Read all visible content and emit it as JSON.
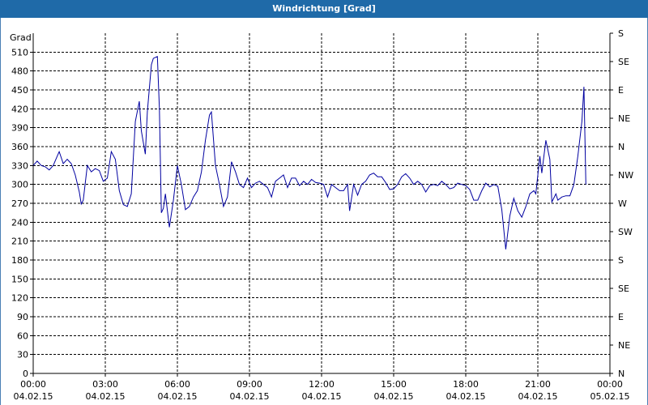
{
  "window": {
    "title": "Windrichtung [Grad]"
  },
  "colors": {
    "titlebar": "#1f6aa8",
    "line": "#0000a0",
    "grid": "#000000"
  },
  "chart_data": {
    "type": "line",
    "title": "Windrichtung [Grad]",
    "ylabel": "Grad",
    "ylim": [
      0,
      540
    ],
    "yticks": [
      0,
      30,
      60,
      90,
      120,
      150,
      180,
      210,
      240,
      270,
      300,
      330,
      360,
      390,
      420,
      450,
      480,
      510
    ],
    "y2ticks": [
      {
        "value": 0,
        "label": "N"
      },
      {
        "value": 45,
        "label": "NE"
      },
      {
        "value": 90,
        "label": "E"
      },
      {
        "value": 135,
        "label": "SE"
      },
      {
        "value": 180,
        "label": "S"
      },
      {
        "value": 225,
        "label": "SW"
      },
      {
        "value": 270,
        "label": "W"
      },
      {
        "value": 315,
        "label": "NW"
      },
      {
        "value": 360,
        "label": "N"
      },
      {
        "value": 405,
        "label": "NE"
      },
      {
        "value": 450,
        "label": "E"
      },
      {
        "value": 495,
        "label": "SE"
      },
      {
        "value": 540,
        "label": "S"
      }
    ],
    "xlim": [
      "04.02.15 00:00",
      "05.02.15 00:00"
    ],
    "xticks": [
      {
        "time": "00:00",
        "date": "04.02.15"
      },
      {
        "time": "03:00",
        "date": "04.02.15"
      },
      {
        "time": "06:00",
        "date": "04.02.15"
      },
      {
        "time": "09:00",
        "date": "04.02.15"
      },
      {
        "time": "12:00",
        "date": "04.02.15"
      },
      {
        "time": "15:00",
        "date": "04.02.15"
      },
      {
        "time": "18:00",
        "date": "04.02.15"
      },
      {
        "time": "21:00",
        "date": "04.02.15"
      },
      {
        "time": "00:00",
        "date": "05.02.15"
      }
    ],
    "grid": true,
    "series": [
      {
        "points": [
          [
            "04.02.15 00:00",
            330
          ],
          [
            "04.02.15 00:10",
            337
          ],
          [
            "04.02.15 00:20",
            330
          ],
          [
            "04.02.15 00:30",
            328
          ],
          [
            "04.02.15 00:40",
            323
          ],
          [
            "04.02.15 00:50",
            330
          ],
          [
            "04.02.15 01:00",
            345
          ],
          [
            "04.02.15 01:05",
            352
          ],
          [
            "04.02.15 01:15",
            333
          ],
          [
            "04.02.15 01:25",
            340
          ],
          [
            "04.02.15 01:35",
            333
          ],
          [
            "04.02.15 01:45",
            315
          ],
          [
            "04.02.15 01:55",
            288
          ],
          [
            "04.02.15 02:00",
            269
          ],
          [
            "04.02.15 02:05",
            275
          ],
          [
            "04.02.15 02:15",
            330
          ],
          [
            "04.02.15 02:25",
            320
          ],
          [
            "04.02.15 02:35",
            325
          ],
          [
            "04.02.15 02:45",
            322
          ],
          [
            "04.02.15 02:55",
            305
          ],
          [
            "04.02.15 03:05",
            310
          ],
          [
            "04.02.15 03:15",
            352
          ],
          [
            "04.02.15 03:25",
            340
          ],
          [
            "04.02.15 03:35",
            290
          ],
          [
            "04.02.15 03:45",
            268
          ],
          [
            "04.02.15 03:55",
            265
          ],
          [
            "04.02.15 04:05",
            285
          ],
          [
            "04.02.15 04:15",
            400
          ],
          [
            "04.02.15 04:25",
            432
          ],
          [
            "04.02.15 04:30",
            385
          ],
          [
            "04.02.15 04:40",
            348
          ],
          [
            "04.02.15 04:45",
            415
          ],
          [
            "04.02.15 04:55",
            490
          ],
          [
            "04.02.15 05:00",
            500
          ],
          [
            "04.02.15 05:10",
            503
          ],
          [
            "04.02.15 05:15",
            420
          ],
          [
            "04.02.15 05:20",
            255
          ],
          [
            "04.02.15 05:25",
            262
          ],
          [
            "04.02.15 05:30",
            285
          ],
          [
            "04.02.15 05:40",
            232
          ],
          [
            "04.02.15 05:50",
            275
          ],
          [
            "04.02.15 06:00",
            330
          ],
          [
            "04.02.15 06:10",
            300
          ],
          [
            "04.02.15 06:20",
            260
          ],
          [
            "04.02.15 06:30",
            265
          ],
          [
            "04.02.15 06:40",
            280
          ],
          [
            "04.02.15 06:50",
            290
          ],
          [
            "04.02.15 07:00",
            320
          ],
          [
            "04.02.15 07:10",
            370
          ],
          [
            "04.02.15 07:20",
            410
          ],
          [
            "04.02.15 07:25",
            415
          ],
          [
            "04.02.15 07:35",
            330
          ],
          [
            "04.02.15 07:45",
            300
          ],
          [
            "04.02.15 07:55",
            265
          ],
          [
            "04.02.15 08:05",
            280
          ],
          [
            "04.02.15 08:15",
            336
          ],
          [
            "04.02.15 08:25",
            320
          ],
          [
            "04.02.15 08:35",
            300
          ],
          [
            "04.02.15 08:45",
            295
          ],
          [
            "04.02.15 08:55",
            310
          ],
          [
            "04.02.15 09:05",
            295
          ],
          [
            "04.02.15 09:15",
            302
          ],
          [
            "04.02.15 09:25",
            305
          ],
          [
            "04.02.15 09:35",
            300
          ],
          [
            "04.02.15 09:45",
            295
          ],
          [
            "04.02.15 09:55",
            280
          ],
          [
            "04.02.15 10:05",
            305
          ],
          [
            "04.02.15 10:15",
            310
          ],
          [
            "04.02.15 10:25",
            315
          ],
          [
            "04.02.15 10:35",
            295
          ],
          [
            "04.02.15 10:45",
            310
          ],
          [
            "04.02.15 10:55",
            310
          ],
          [
            "04.02.15 11:05",
            298
          ],
          [
            "04.02.15 11:15",
            305
          ],
          [
            "04.02.15 11:25",
            300
          ],
          [
            "04.02.15 11:35",
            308
          ],
          [
            "04.02.15 11:45",
            303
          ],
          [
            "04.02.15 11:55",
            302
          ],
          [
            "04.02.15 12:05",
            300
          ],
          [
            "04.02.15 12:15",
            280
          ],
          [
            "04.02.15 12:25",
            300
          ],
          [
            "04.02.15 12:35",
            295
          ],
          [
            "04.02.15 12:45",
            290
          ],
          [
            "04.02.15 12:55",
            290
          ],
          [
            "04.02.15 13:05",
            300
          ],
          [
            "04.02.15 13:10",
            258
          ],
          [
            "04.02.15 13:20",
            300
          ],
          [
            "04.02.15 13:30",
            283
          ],
          [
            "04.02.15 13:40",
            300
          ],
          [
            "04.02.15 13:50",
            305
          ],
          [
            "04.02.15 14:00",
            315
          ],
          [
            "04.02.15 14:10",
            318
          ],
          [
            "04.02.15 14:20",
            312
          ],
          [
            "04.02.15 14:30",
            312
          ],
          [
            "04.02.15 14:40",
            303
          ],
          [
            "04.02.15 14:50",
            292
          ],
          [
            "04.02.15 15:00",
            293
          ],
          [
            "04.02.15 15:10",
            300
          ],
          [
            "04.02.15 15:20",
            312
          ],
          [
            "04.02.15 15:30",
            317
          ],
          [
            "04.02.15 15:40",
            310
          ],
          [
            "04.02.15 15:50",
            300
          ],
          [
            "04.02.15 16:00",
            305
          ],
          [
            "04.02.15 16:10",
            300
          ],
          [
            "04.02.15 16:20",
            288
          ],
          [
            "04.02.15 16:30",
            298
          ],
          [
            "04.02.15 16:40",
            300
          ],
          [
            "04.02.15 16:50",
            298
          ],
          [
            "04.02.15 17:00",
            305
          ],
          [
            "04.02.15 17:10",
            300
          ],
          [
            "04.02.15 17:20",
            293
          ],
          [
            "04.02.15 17:30",
            295
          ],
          [
            "04.02.15 17:40",
            302
          ],
          [
            "04.02.15 17:50",
            300
          ],
          [
            "04.02.15 18:00",
            298
          ],
          [
            "04.02.15 18:10",
            292
          ],
          [
            "04.02.15 18:20",
            275
          ],
          [
            "04.02.15 18:30",
            275
          ],
          [
            "04.02.15 18:40",
            290
          ],
          [
            "04.02.15 18:50",
            302
          ],
          [
            "04.02.15 19:00",
            296
          ],
          [
            "04.02.15 19:10",
            300
          ],
          [
            "04.02.15 19:20",
            297
          ],
          [
            "04.02.15 19:30",
            260
          ],
          [
            "04.02.15 19:40",
            197
          ],
          [
            "04.02.15 19:50",
            250
          ],
          [
            "04.02.15 20:00",
            278
          ],
          [
            "04.02.15 20:10",
            258
          ],
          [
            "04.02.15 20:20",
            248
          ],
          [
            "04.02.15 20:30",
            265
          ],
          [
            "04.02.15 20:40",
            285
          ],
          [
            "04.02.15 20:50",
            290
          ],
          [
            "04.02.15 20:55",
            285
          ],
          [
            "04.02.15 21:05",
            345
          ],
          [
            "04.02.15 21:10",
            318
          ],
          [
            "04.02.15 21:20",
            370
          ],
          [
            "04.02.15 21:30",
            340
          ],
          [
            "04.02.15 21:35",
            272
          ],
          [
            "04.02.15 21:45",
            285
          ],
          [
            "04.02.15 21:50",
            275
          ],
          [
            "04.02.15 22:00",
            280
          ],
          [
            "04.02.15 22:10",
            282
          ],
          [
            "04.02.15 22:20",
            282
          ],
          [
            "04.02.15 22:30",
            300
          ],
          [
            "04.02.15 22:40",
            345
          ],
          [
            "04.02.15 22:50",
            400
          ],
          [
            "04.02.15 22:55",
            455
          ],
          [
            "04.02.15 23:00",
            300
          ]
        ]
      }
    ]
  }
}
